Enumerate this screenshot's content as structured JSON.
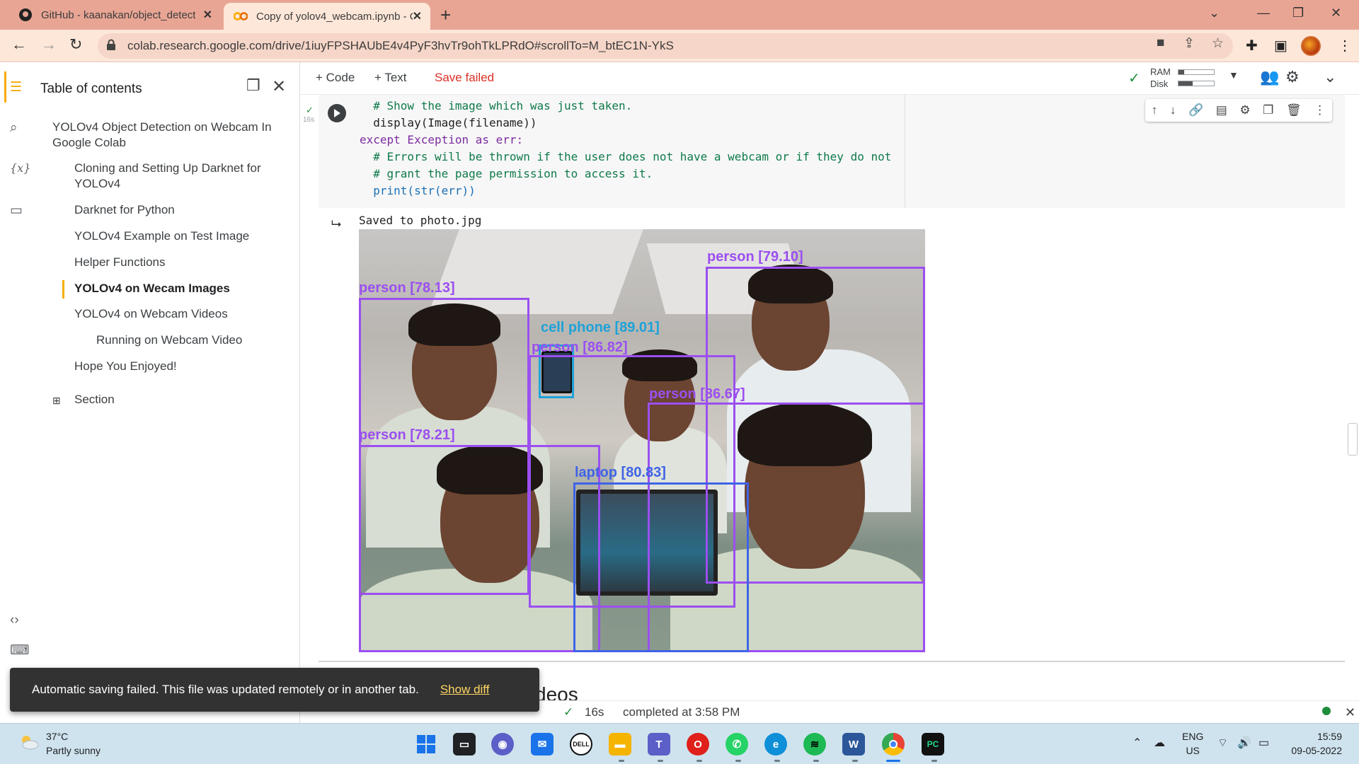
{
  "browser": {
    "tabs": [
      {
        "label": "GitHub - kaanakan/object_detect",
        "active": false
      },
      {
        "label": "Copy of yolov4_webcam.ipynb - C",
        "active": true
      }
    ],
    "url": "colab.research.google.com/drive/1iuyFPSHAUbE4v4PyF3hvTr9ohTkLPRdO#scrollTo=M_btEC1N-YkS"
  },
  "toc": {
    "title": "Table of contents",
    "items": [
      {
        "label": "YOLOv4 Object Detection on Webcam In Google Colab",
        "level": 1,
        "active": false
      },
      {
        "label": "Cloning and Setting Up Darknet for YOLOv4",
        "level": 2,
        "active": false
      },
      {
        "label": "Darknet for Python",
        "level": 2,
        "active": false
      },
      {
        "label": "YOLOv4 Example on Test Image",
        "level": 2,
        "active": false
      },
      {
        "label": "Helper Functions",
        "level": 2,
        "active": false
      },
      {
        "label": "YOLOv4 on Wecam Images",
        "level": 2,
        "active": true
      },
      {
        "label": "YOLOv4 on Webcam Videos",
        "level": 2,
        "active": false
      },
      {
        "label": "Running on Webcam Video",
        "level": 3,
        "active": false
      },
      {
        "label": "Hope You Enjoyed!",
        "level": 2,
        "active": false
      }
    ],
    "section_label": "Section"
  },
  "notebook": {
    "add_code": "+ Code",
    "add_text": "+ Text",
    "save_status": "Save failed",
    "ram_label": "RAM",
    "disk_label": "Disk",
    "ram_usage": 0.15,
    "disk_usage": 0.4,
    "exec_time": "16s",
    "code_lines": [
      "  # Show the image which was just taken.",
      "  display(Image(filename))",
      "except Exception as err:",
      "  # Errors will be thrown if the user does not have a webcam or if they do not",
      "  # grant the page permission to access it.",
      "  print(str(err))"
    ],
    "output_text": "Saved to photo.jpg",
    "detections": [
      {
        "label": "person [79.10]",
        "color": "#9b4ff0"
      },
      {
        "label": "person [78.13]",
        "color": "#9b4ff0"
      },
      {
        "label": "cell phone [89.01]",
        "color": "#1ea2d8"
      },
      {
        "label": "person [86.82]",
        "color": "#9b4ff0"
      },
      {
        "label": "person [86.67]",
        "color": "#9b4ff0"
      },
      {
        "label": "person [78.21]",
        "color": "#9b4ff0"
      },
      {
        "label": "laptop [80.83]",
        "color": "#3f63e6"
      }
    ],
    "behind_text": "deos"
  },
  "status": {
    "time": "16s",
    "text": "completed at 3:58 PM"
  },
  "toast": {
    "message": "Automatic saving failed. This file was updated remotely or in another tab.",
    "link": "Show diff"
  },
  "taskbar": {
    "temp": "37°C",
    "weather": "Partly sunny",
    "lang": "ENG",
    "region": "US",
    "time": "15:59",
    "date": "09-05-2022"
  }
}
